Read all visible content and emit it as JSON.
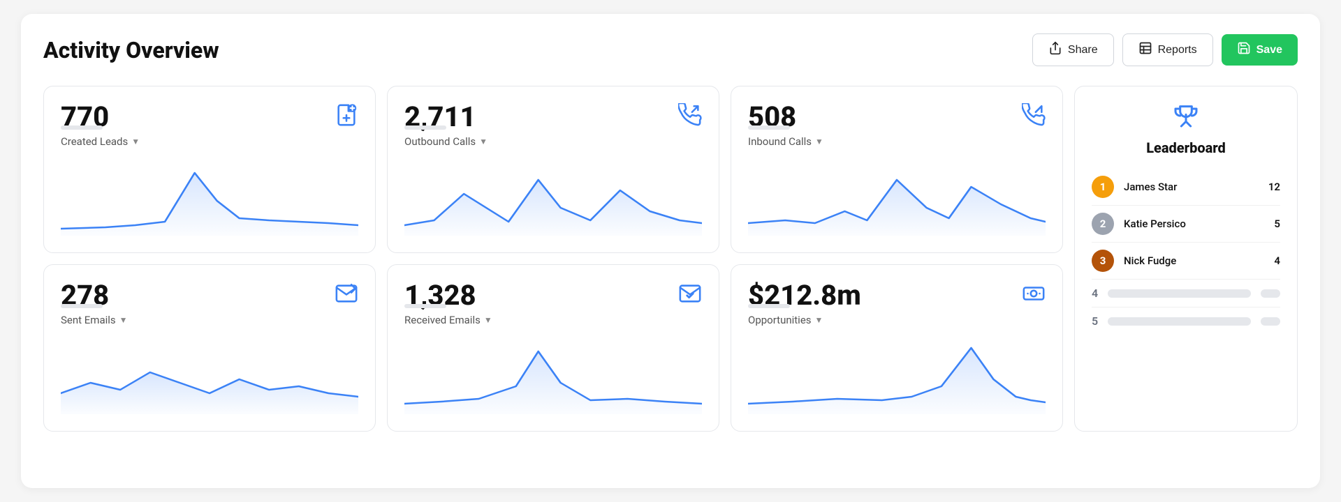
{
  "header": {
    "title": "Activity Overview",
    "share_label": "Share",
    "reports_label": "Reports",
    "save_label": "Save"
  },
  "cards": [
    {
      "id": "created-leads",
      "value": "770",
      "label": "Created Leads",
      "icon": "file-plus",
      "chart": "peak-right"
    },
    {
      "id": "outbound-calls",
      "value": "2,711",
      "label": "Outbound Calls",
      "icon": "phone-outbound",
      "chart": "multi-peak"
    },
    {
      "id": "inbound-calls",
      "value": "508",
      "label": "Inbound Calls",
      "icon": "phone-inbound",
      "chart": "multi-peak-2"
    },
    {
      "id": "sent-emails",
      "value": "278",
      "label": "Sent Emails",
      "icon": "mail-outbound",
      "chart": "wavy"
    },
    {
      "id": "received-emails",
      "value": "1,328",
      "label": "Received Emails",
      "icon": "mail-check",
      "chart": "single-peak"
    },
    {
      "id": "opportunities",
      "value": "$212.8m",
      "label": "Opportunities",
      "icon": "cash",
      "chart": "spike-right"
    }
  ],
  "leaderboard": {
    "title": "Leaderboard",
    "entries": [
      {
        "rank": 1,
        "name": "James Star",
        "score": 12,
        "rank_style": "gold"
      },
      {
        "rank": 2,
        "name": "Katie Persico",
        "score": 5,
        "rank_style": "silver"
      },
      {
        "rank": 3,
        "name": "Nick Fudge",
        "score": 4,
        "rank_style": "bronze"
      },
      {
        "rank": 4,
        "name": "",
        "score": "",
        "rank_style": "num"
      },
      {
        "rank": 5,
        "name": "",
        "score": "",
        "rank_style": "num"
      }
    ]
  }
}
